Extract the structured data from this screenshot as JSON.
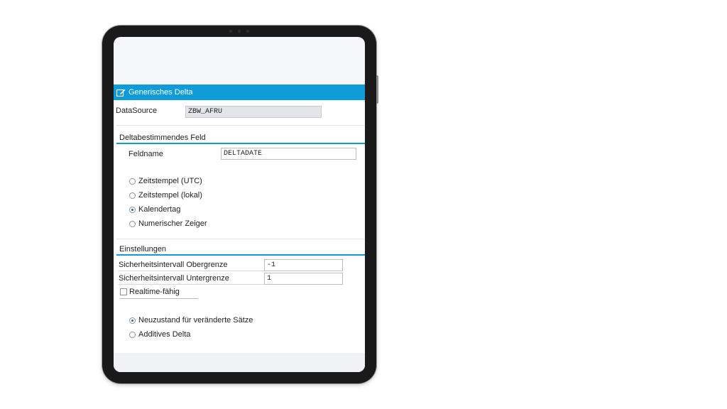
{
  "window": {
    "title": "Generisches Delta",
    "accent": "#0f9bd7"
  },
  "datasource": {
    "label": "DataSource",
    "value": "ZBW_AFRU"
  },
  "delta_field": {
    "heading": "Deltabestimmendes Feld",
    "fieldname_label": "Feldname",
    "fieldname_value": "DELTADATE",
    "options": [
      {
        "label": "Zeitstempel (UTC)",
        "selected": false
      },
      {
        "label": "Zeitstempel (lokal)",
        "selected": false
      },
      {
        "label": "Kalendertag",
        "selected": true
      },
      {
        "label": "Numerischer Zeiger",
        "selected": false
      }
    ]
  },
  "settings": {
    "heading": "Einstellungen",
    "upper_label": "Sicherheitsintervall Obergrenze",
    "upper_value": "-1",
    "lower_label": "Sicherheitsintervall Untergrenze",
    "lower_value": "1",
    "realtime_label": "Realtime-fähig",
    "realtime_checked": false,
    "options": [
      {
        "label": "Neuzustand für veränderte Sätze",
        "selected": true
      },
      {
        "label": "Additives Delta",
        "selected": false
      }
    ]
  }
}
